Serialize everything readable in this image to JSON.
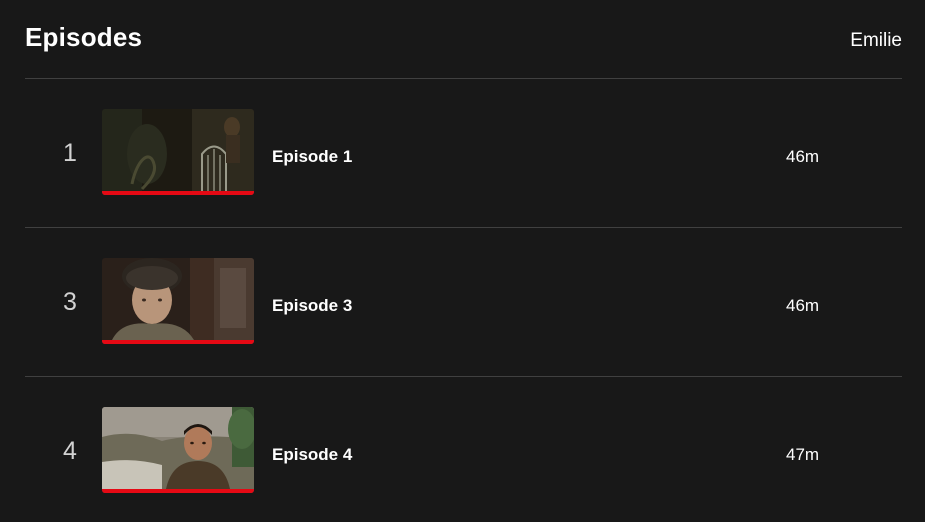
{
  "header": {
    "title": "Episodes",
    "season": "Emilie"
  },
  "colors": {
    "background": "#181818",
    "divider": "#404040",
    "progress": "#e50914"
  },
  "episodes": [
    {
      "index": "1",
      "title": "Episode 1",
      "duration": "46m",
      "progress": 1.0,
      "thumbnail": "dark-interior-scene"
    },
    {
      "index": "3",
      "title": "Episode 3",
      "duration": "46m",
      "progress": 1.0,
      "thumbnail": "child-in-fur-hat-scene"
    },
    {
      "index": "4",
      "title": "Episode 4",
      "duration": "47m",
      "progress": 1.0,
      "thumbnail": "man-outdoors-scene"
    }
  ]
}
